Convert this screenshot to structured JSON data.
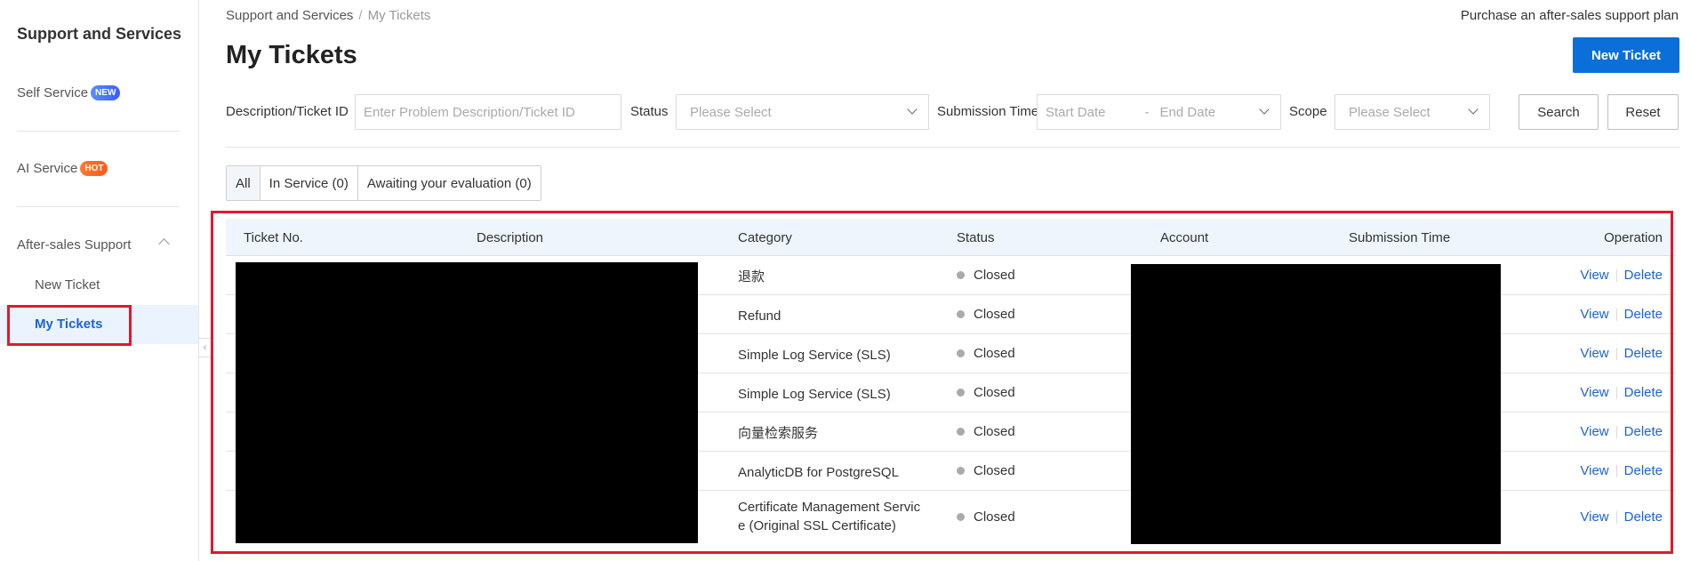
{
  "sidebar": {
    "title": "Support and Services",
    "self_service": {
      "label": "Self Service",
      "badge": "NEW"
    },
    "ai_service": {
      "label": "AI Service",
      "badge": "HOT"
    },
    "after_sales": {
      "label": "After-sales Support"
    },
    "sub_items": [
      "New Ticket",
      "My Tickets"
    ]
  },
  "breadcrumb": {
    "root": "Support and Services",
    "separator": "/",
    "current": "My Tickets"
  },
  "top_link": "Purchase an after-sales support plan",
  "page_title": "My Tickets",
  "new_ticket_button": "New Ticket",
  "filters": {
    "desc_label": "Description/Ticket ID",
    "desc_placeholder": "Enter Problem Description/Ticket ID",
    "status_label": "Status",
    "status_placeholder": "Please Select",
    "time_label": "Submission Time",
    "start_placeholder": "Start Date",
    "range_sep": "-",
    "end_placeholder": "End Date",
    "scope_label": "Scope",
    "scope_placeholder": "Please Select",
    "search_button": "Search",
    "reset_button": "Reset"
  },
  "tabs": [
    "All",
    "In Service (0)",
    "Awaiting your evaluation (0)"
  ],
  "table": {
    "headers": {
      "ticket_no": "Ticket No.",
      "description": "Description",
      "category": "Category",
      "status": "Status",
      "account": "Account",
      "submission_time": "Submission Time",
      "operation": "Operation"
    },
    "rows": [
      {
        "category": "退款",
        "status": "Closed",
        "view": "View",
        "delete": "Delete"
      },
      {
        "category": "Refund",
        "status": "Closed",
        "view": "View",
        "delete": "Delete"
      },
      {
        "category": "Simple Log Service (SLS)",
        "status": "Closed",
        "view": "View",
        "delete": "Delete"
      },
      {
        "category": "Simple Log Service (SLS)",
        "status": "Closed",
        "view": "View",
        "delete": "Delete"
      },
      {
        "category": "向量检索服务",
        "status": "Closed",
        "view": "View",
        "delete": "Delete"
      },
      {
        "category": "AnalyticDB for PostgreSQL",
        "status": "Closed",
        "view": "View",
        "delete": "Delete"
      },
      {
        "category": "Certificate Management Servic e (Original SSL Certificate)",
        "status": "Closed",
        "view": "View",
        "delete": "Delete"
      }
    ]
  },
  "colors": {
    "accent": "#0b6fd9",
    "link": "#1b63d6",
    "highlight_box": "#e0192d",
    "status_dot": "#aaaaaa"
  }
}
